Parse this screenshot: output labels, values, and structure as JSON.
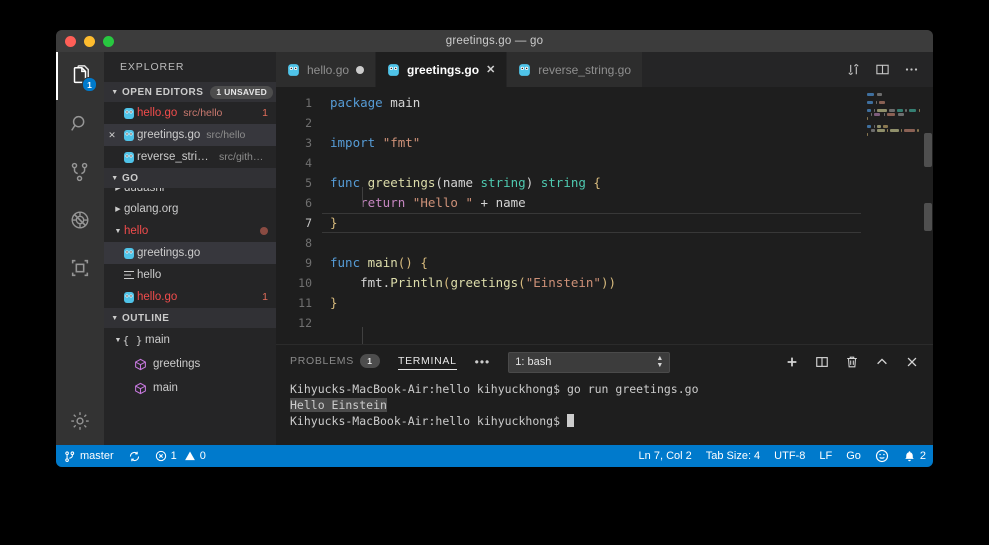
{
  "titlebar": {
    "title": "greetings.go — go"
  },
  "activitybar": {
    "items": [
      {
        "name": "explorer",
        "badge": "1"
      },
      {
        "name": "search",
        "badge": ""
      },
      {
        "name": "source-control",
        "badge": ""
      },
      {
        "name": "debug",
        "badge": ""
      },
      {
        "name": "extensions",
        "badge": ""
      },
      {
        "name": "settings",
        "badge": ""
      }
    ]
  },
  "sidebar": {
    "title": "EXPLORER",
    "open_editors": {
      "header": "OPEN EDITORS",
      "badge": "1 UNSAVED",
      "items": [
        {
          "label": "hello.go",
          "sub": "src/hello",
          "count": "1",
          "state": "dirty"
        },
        {
          "label": "greetings.go",
          "sub": "src/hello",
          "count": "",
          "state": "active"
        },
        {
          "label": "reverse_string.go",
          "sub": "src/github....",
          "count": "",
          "state": "plain"
        }
      ]
    },
    "go_section": {
      "header": "GO",
      "clipped_label": "dudashi",
      "items": [
        {
          "label": "golang.org",
          "type": "folder-collapsed"
        },
        {
          "label": "hello",
          "type": "folder-expanded-modified"
        },
        {
          "label": "greetings.go",
          "type": "go-file-selected"
        },
        {
          "label": "hello",
          "type": "binary"
        },
        {
          "label": "hello.go",
          "type": "go-file-error",
          "count": "1"
        }
      ]
    },
    "outline": {
      "header": "OUTLINE",
      "items": [
        {
          "label": "main",
          "kind": "namespace"
        },
        {
          "label": "greetings",
          "kind": "function"
        },
        {
          "label": "main",
          "kind": "function"
        }
      ]
    }
  },
  "tabs": [
    {
      "label": "hello.go",
      "state": "dirty"
    },
    {
      "label": "greetings.go",
      "state": "active"
    },
    {
      "label": "reverse_string.go",
      "state": "plain"
    }
  ],
  "tab_actions": [
    "split-compare-icon",
    "split-editor-icon",
    "more-actions-icon"
  ],
  "editor": {
    "line_numbers": [
      "1",
      "2",
      "3",
      "4",
      "5",
      "6",
      "7",
      "8",
      "9",
      "10",
      "11",
      "12"
    ],
    "active_line": 7,
    "lines": [
      [
        {
          "t": "package",
          "c": "kw"
        },
        {
          "t": " main",
          "c": "pl"
        }
      ],
      [],
      [
        {
          "t": "import",
          "c": "kw"
        },
        {
          "t": " ",
          "c": "pl"
        },
        {
          "t": "\"fmt\"",
          "c": "str"
        }
      ],
      [],
      [
        {
          "t": "func",
          "c": "kw"
        },
        {
          "t": " ",
          "c": "pl"
        },
        {
          "t": "greetings",
          "c": "fn"
        },
        {
          "t": "(name ",
          "c": "pl"
        },
        {
          "t": "string",
          "c": "typ"
        },
        {
          "t": ") ",
          "c": "pl"
        },
        {
          "t": "string",
          "c": "typ"
        },
        {
          "t": " {",
          "c": "br"
        }
      ],
      [
        {
          "t": "    ",
          "c": "pl"
        },
        {
          "t": "return",
          "c": "ret"
        },
        {
          "t": " ",
          "c": "pl"
        },
        {
          "t": "\"Hello \"",
          "c": "str"
        },
        {
          "t": " + name",
          "c": "pl"
        }
      ],
      [
        {
          "t": "}",
          "c": "br"
        }
      ],
      [],
      [
        {
          "t": "func",
          "c": "kw"
        },
        {
          "t": " ",
          "c": "pl"
        },
        {
          "t": "main",
          "c": "fn"
        },
        {
          "t": "() {",
          "c": "br"
        }
      ],
      [
        {
          "t": "    fmt.",
          "c": "pl"
        },
        {
          "t": "Println",
          "c": "fn"
        },
        {
          "t": "(",
          "c": "br"
        },
        {
          "t": "greetings",
          "c": "fn"
        },
        {
          "t": "(",
          "c": "br"
        },
        {
          "t": "\"Einstein\"",
          "c": "str"
        },
        {
          "t": "))",
          "c": "br"
        }
      ],
      [
        {
          "t": "}",
          "c": "br"
        }
      ],
      []
    ]
  },
  "panel": {
    "tabs": [
      {
        "label": "PROBLEMS",
        "badge": "1",
        "active": false
      },
      {
        "label": "TERMINAL",
        "badge": "",
        "active": true
      }
    ],
    "more_label": "•••",
    "terminal_select": "1: bash",
    "actions": [
      "add-terminal-icon",
      "split-terminal-icon",
      "kill-terminal-icon",
      "maximize-panel-icon",
      "close-panel-icon"
    ],
    "terminal_lines": [
      {
        "text": "Kihyucks-MacBook-Air:hello kihyuckhong$ go run greetings.go",
        "highlight": false
      },
      {
        "text": "Hello Einstein",
        "highlight": true
      },
      {
        "text": "Kihyucks-MacBook-Air:hello kihyuckhong$ ",
        "highlight": false,
        "cursor": true
      }
    ]
  },
  "statusbar": {
    "branch": "master",
    "sync_icon": "sync-icon",
    "errors": "1",
    "warnings": "0",
    "position": "Ln 7, Col 2",
    "tab_size": "Tab Size: 4",
    "encoding": "UTF-8",
    "eol": "LF",
    "language": "Go",
    "smiley": "smiley-icon",
    "bell_count": "2"
  },
  "colors": {
    "accent": "#007acc",
    "error": "#f14c4c",
    "keyword": "#569cd6",
    "function": "#dcdcaa",
    "type": "#4ec9b0",
    "string": "#ce9178",
    "control": "#c586c0"
  }
}
